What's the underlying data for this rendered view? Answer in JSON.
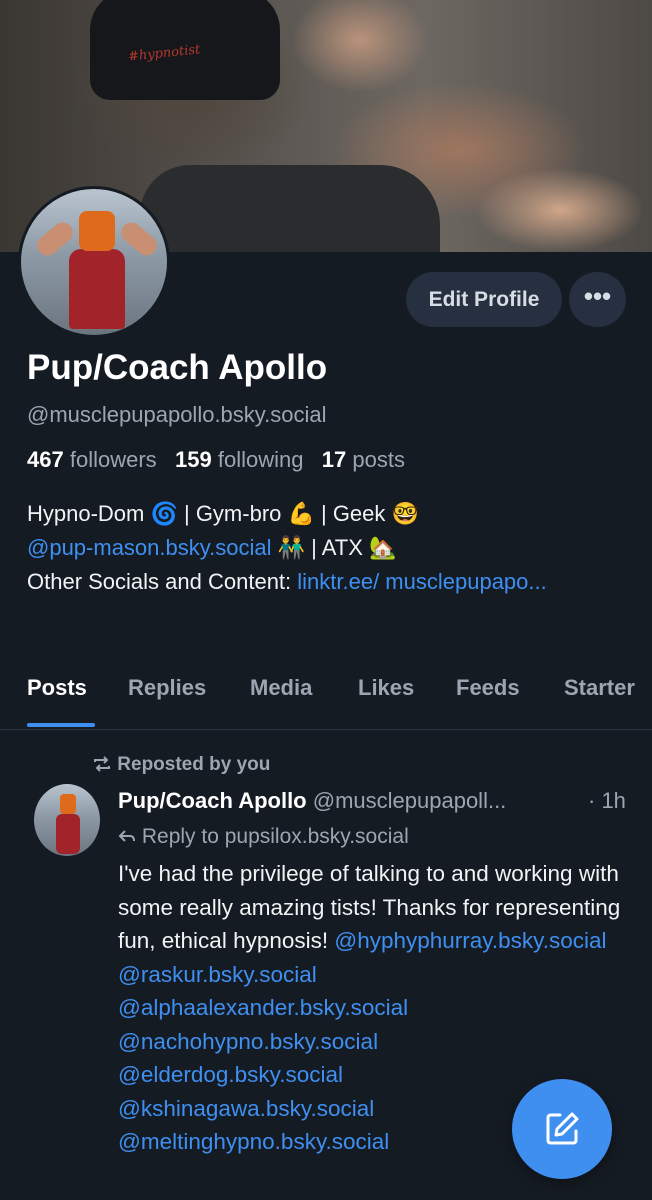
{
  "profile": {
    "display_name": "Pup/Coach Apollo",
    "handle": "@musclepupapollo.bsky.social",
    "followers_count": "467",
    "followers_label": "followers",
    "following_count": "159",
    "following_label": "following",
    "posts_count": "17",
    "posts_label": "posts",
    "banner_text": "#hypnotist",
    "bio_line1": "Hypno-Dom 🌀 | Gym-bro 💪 | Geek 🤓",
    "bio_mention": "@pup-mason.bsky.social",
    "bio_line2_rest": " 👬 | ATX 🏡",
    "bio_line3_prefix": "Other Socials and Content: ",
    "bio_link": "linktr.ee/ musclepupapo..."
  },
  "actions": {
    "edit_profile_label": "Edit Profile",
    "more_label": "•••"
  },
  "tabs": [
    "Posts",
    "Replies",
    "Media",
    "Likes",
    "Feeds",
    "Starter"
  ],
  "active_tab": "Posts",
  "post": {
    "repost_label": "Reposted by you",
    "author": "Pup/Coach Apollo",
    "author_handle": "@musclepupapoll...",
    "time": "· 1h",
    "reply_to": "Reply to pupsilox.bsky.social",
    "text": "I've had the privilege of talking to and working with some really amazing tists! Thanks for representing fun, ethical hypnosis! ",
    "mentions": [
      "@hyphyphurray.bsky.social",
      "@raskur.bsky.social",
      "@alphaalexander.bsky.social",
      "@nachohypno.bsky.social",
      "@elderdog.bsky.social",
      "@kshinagawa.bsky.social",
      "@meltinghypno.bsky.social"
    ]
  },
  "colors": {
    "background": "#151b23",
    "accent": "#3f8ff1",
    "muted_text": "#9ba6b2",
    "button_bg": "#263040"
  },
  "icons": {
    "more": "ellipsis-icon",
    "repost": "repost-icon",
    "reply": "reply-arrow-icon",
    "compose": "compose-icon"
  }
}
